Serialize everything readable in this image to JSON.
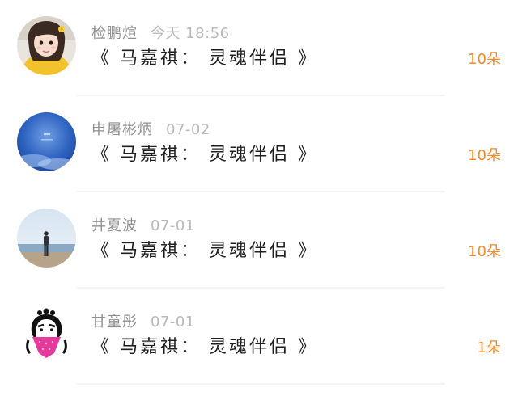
{
  "items": [
    {
      "user": "检鹏煊",
      "time": "今天 18:56",
      "title": "《 马嘉祺： 灵魂伴侣 》",
      "count": "10朵",
      "avatar": "girl-selfie-avatar"
    },
    {
      "user": "申屠彬炳",
      "time": "07-02",
      "title": "《 马嘉祺： 灵魂伴侣 》",
      "count": "10朵",
      "avatar": "blue-sky-avatar"
    },
    {
      "user": "井夏波",
      "time": "07-01",
      "title": "《 马嘉祺： 灵魂伴侣 》",
      "count": "10朵",
      "avatar": "seaside-person-avatar"
    },
    {
      "user": "甘童彤",
      "time": "07-01",
      "title": "《 马嘉祺： 灵魂伴侣 》",
      "count": "1朵",
      "avatar": "frida-bandana-avatar"
    }
  ],
  "colors": {
    "count": "#f08a2c",
    "name": "#8f8f8f",
    "time": "#b9b9b9",
    "title": "#1f1f1f",
    "divider": "#f3f3f3"
  }
}
